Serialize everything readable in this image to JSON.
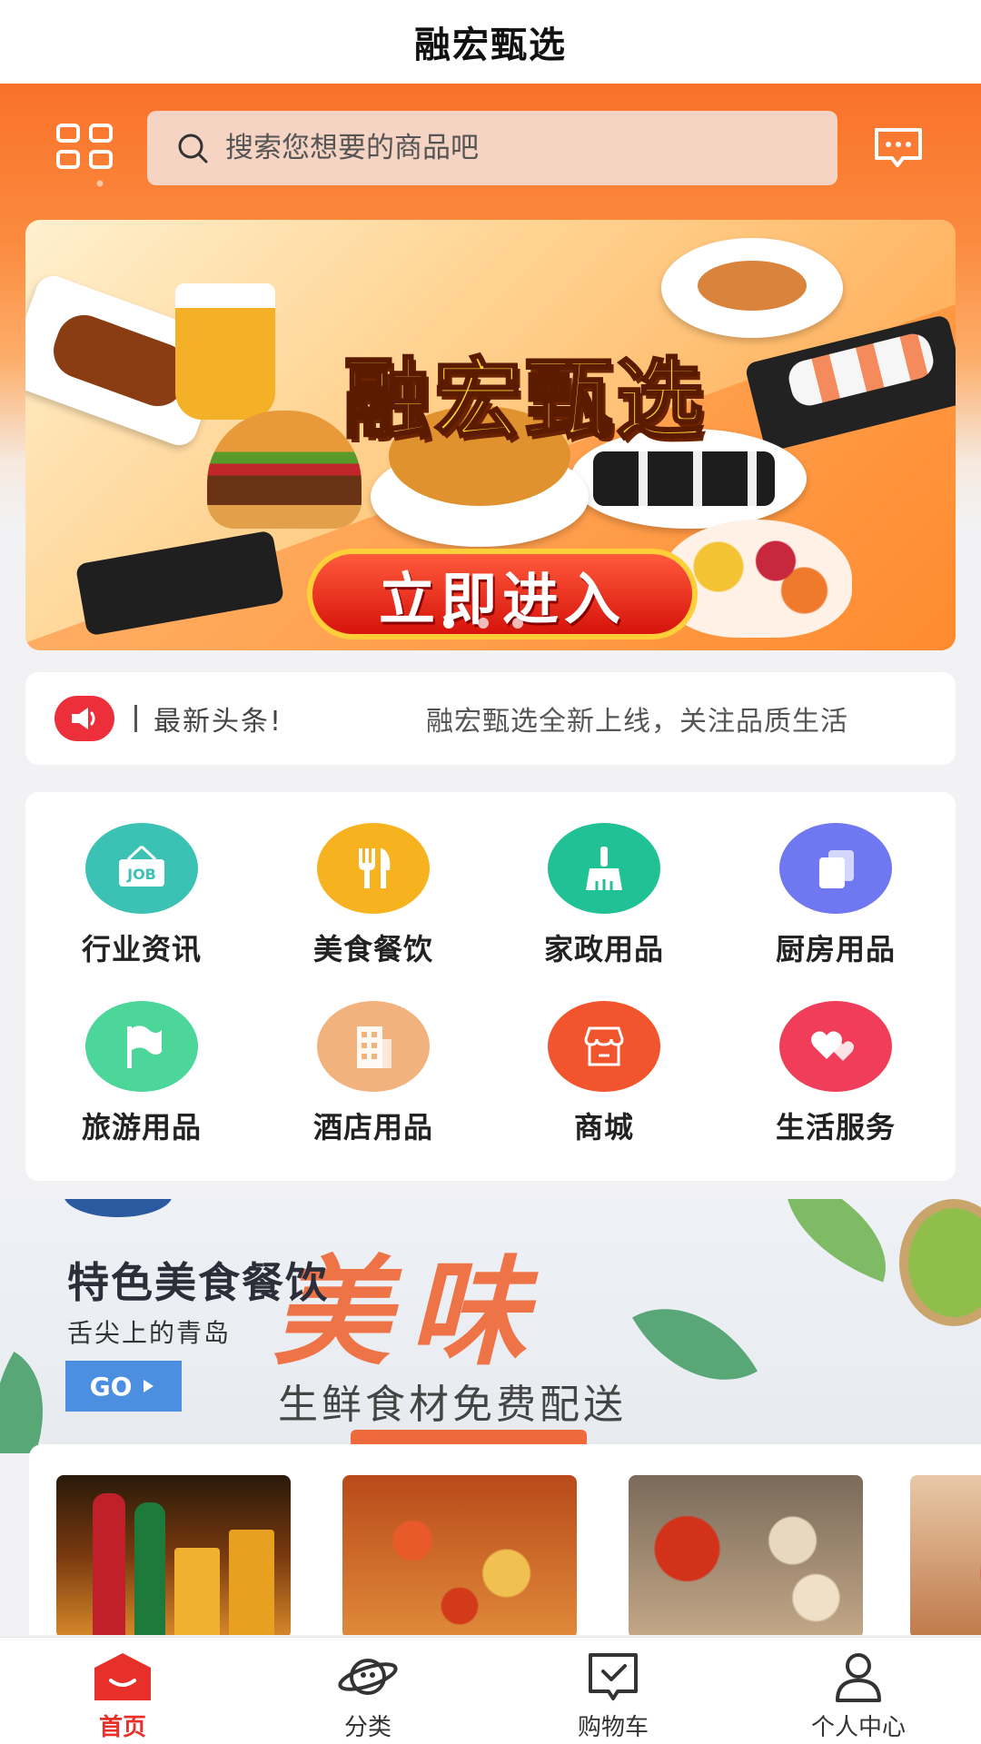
{
  "app": {
    "title": "融宏甄选"
  },
  "header": {
    "search": {
      "placeholder": "搜索您想要的商品吧"
    }
  },
  "banner": {
    "title": "融宏甄选",
    "button_label": "立即进入",
    "slide_count": 3,
    "active_slide": 1
  },
  "news": {
    "label": "最新头条!",
    "text": "融宏甄选全新上线，关注品质生活"
  },
  "categories": [
    {
      "label": "行业资讯",
      "icon": "job-sign-icon",
      "color": "#3cc2b4"
    },
    {
      "label": "美食餐饮",
      "icon": "fork-knife-icon",
      "color": "#f7b21f"
    },
    {
      "label": "家政用品",
      "icon": "broom-icon",
      "color": "#1fc195"
    },
    {
      "label": "厨房用品",
      "icon": "copy-cards-icon",
      "color": "#6f78f0"
    },
    {
      "label": "旅游用品",
      "icon": "flag-icon",
      "color": "#4cd69a"
    },
    {
      "label": "酒店用品",
      "icon": "building-icon",
      "color": "#f2b27e"
    },
    {
      "label": "商城",
      "icon": "shop-icon",
      "color": "#f2542d"
    },
    {
      "label": "生活服务",
      "icon": "hearts-icon",
      "color": "#f03e5a"
    }
  ],
  "promo": {
    "title": "特色美食餐饮",
    "subtitle": "舌尖上的青岛",
    "go_label": "GO",
    "art_text": "美味",
    "slogan": "生鲜食材免费配送"
  },
  "products": [
    {
      "name": "beer-product-image"
    },
    {
      "name": "crayfish-product-image"
    },
    {
      "name": "seafood-platter-product-image"
    },
    {
      "name": "crab-product-image"
    }
  ],
  "tabbar": {
    "tabs": [
      {
        "label": "首页",
        "icon": "home-icon",
        "active": true
      },
      {
        "label": "分类",
        "icon": "planet-icon",
        "active": false
      },
      {
        "label": "购物车",
        "icon": "cart-check-icon",
        "active": false
      },
      {
        "label": "个人中心",
        "icon": "user-icon",
        "active": false
      }
    ]
  },
  "colors": {
    "accent": "#f9712a",
    "active_tab": "#e8302a",
    "news_horn": "#ec2f3a",
    "go_button": "#4c8fe0"
  }
}
